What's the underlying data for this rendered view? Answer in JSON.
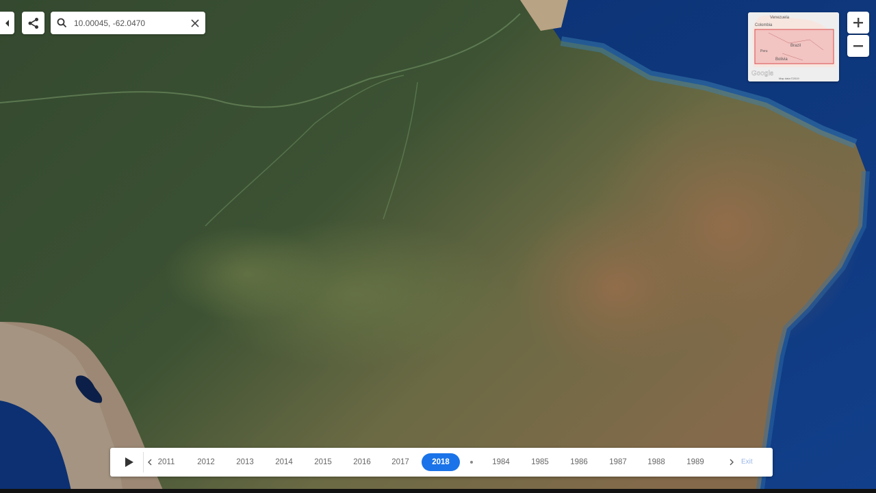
{
  "search": {
    "value": "10.00045, -62.0470",
    "placeholder": ""
  },
  "minimap": {
    "labels": [
      "Venezuela",
      "Colombia",
      "Brazil",
      "Peru",
      "Bolivia"
    ],
    "logo": "Google",
    "footer": "Map data ©2019"
  },
  "timeline": {
    "years_before": [
      "2011",
      "2012",
      "2013",
      "2014",
      "2015",
      "2016",
      "2017"
    ],
    "active_year": "2018",
    "years_after": [
      "1984",
      "1985",
      "1986",
      "1987",
      "1988",
      "1989"
    ],
    "extra_label": "Exit"
  },
  "colors": {
    "accent": "#1a73e8",
    "ocean": "#0d3778",
    "forest": "#2f4a2f",
    "cerrado": "#7a6a45"
  },
  "icons": {
    "collapse": "chevron-left-icon",
    "share": "share-icon",
    "search": "search-icon",
    "clear": "close-icon",
    "zoom_in": "plus-icon",
    "zoom_out": "minus-icon",
    "play": "play-icon"
  }
}
